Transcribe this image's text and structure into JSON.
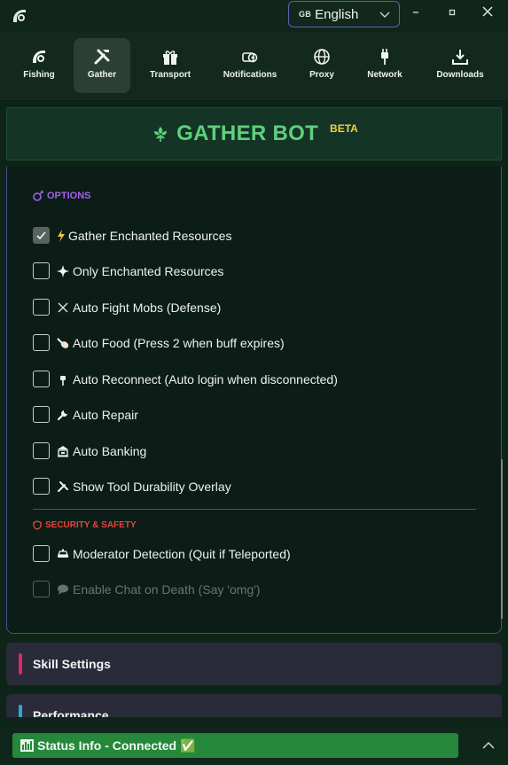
{
  "window": {
    "language_flag": "GB",
    "language_name": "English"
  },
  "tabs": [
    {
      "label": "Fishing",
      "icon": "fishing-icon"
    },
    {
      "label": "Gather",
      "icon": "tools-icon",
      "active": true
    },
    {
      "label": "Transport",
      "icon": "gift-icon"
    },
    {
      "label": "Notifications",
      "icon": "bell-icon"
    },
    {
      "label": "Proxy",
      "icon": "globe-icon"
    },
    {
      "label": "Network",
      "icon": "plug-icon"
    },
    {
      "label": "Downloads",
      "icon": "download-icon"
    }
  ],
  "header": {
    "title": "GATHER BOT",
    "badge": "BETA"
  },
  "options": {
    "heading": "OPTIONS",
    "items": [
      {
        "label": "Gather Enchanted Resources",
        "icon": "lightning-icon",
        "checked": true
      },
      {
        "label": "Only Enchanted Resources",
        "icon": "sparkle-icon",
        "checked": false
      },
      {
        "label": "Auto Fight Mobs (Defense)",
        "icon": "crossed-swords-icon",
        "checked": false
      },
      {
        "label": "Auto Food (Press 2 when buff expires)",
        "icon": "drumstick-icon",
        "checked": false
      },
      {
        "label": "Auto Reconnect (Auto login when disconnected)",
        "icon": "plug-icon",
        "checked": false
      },
      {
        "label": "Auto Repair",
        "icon": "wrench-icon",
        "checked": false
      },
      {
        "label": "Auto Banking",
        "icon": "bank-icon",
        "checked": false
      },
      {
        "label": "Show Tool Durability Overlay",
        "icon": "tools-icon",
        "checked": false
      }
    ]
  },
  "security": {
    "heading": "SECURITY & SAFETY",
    "items": [
      {
        "label": "Moderator Detection (Quit if Teleported)",
        "icon": "police-car-icon",
        "checked": false
      },
      {
        "label": "Enable Chat on Death (Say 'omg')",
        "icon": "speech-bubble-icon",
        "checked": false,
        "disabled": true
      }
    ]
  },
  "sections": [
    {
      "label": "Skill Settings",
      "accent": "#e0256b"
    },
    {
      "label": "Performance",
      "accent": "#29a8e0"
    }
  ],
  "status": {
    "text": "Status Info - Connected ✅",
    "color": "#25883a"
  },
  "colors": {
    "accent_green": "#5fd07c",
    "beta_yellow": "#f1d13a",
    "options_purple": "#a35ff0",
    "security_red": "#e8453c"
  }
}
